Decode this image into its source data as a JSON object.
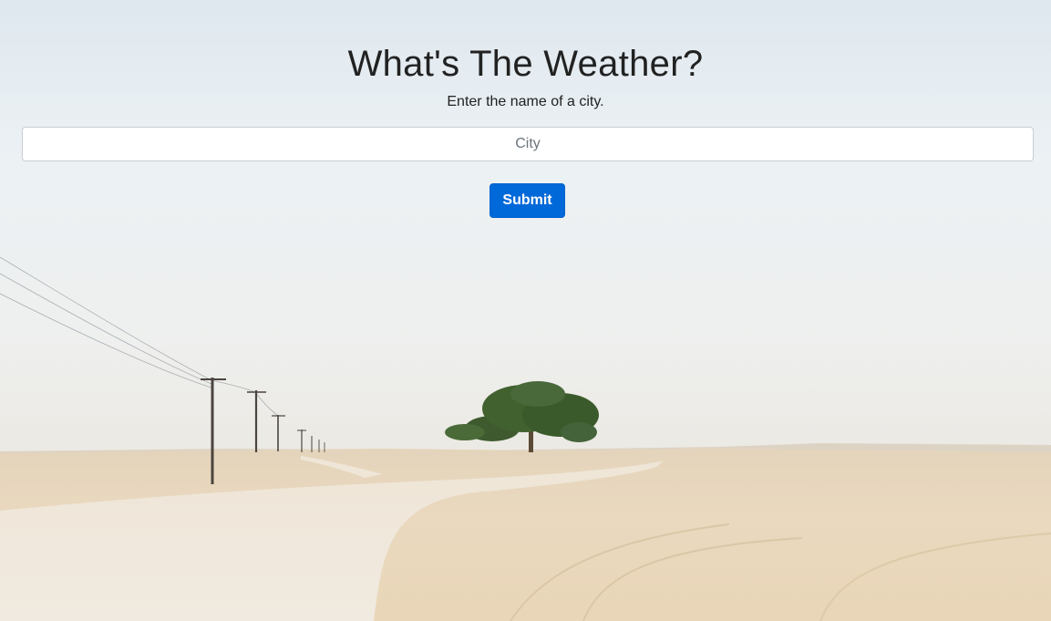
{
  "header": {
    "title": "What's The Weather?",
    "subtitle": "Enter the name of a city."
  },
  "form": {
    "city_placeholder": "City",
    "city_value": "",
    "submit_label": "Submit"
  },
  "colors": {
    "button": "#0069d9",
    "button_text": "#ffffff",
    "sky": "#e8eef3",
    "sand": "#e9d9be"
  },
  "background": {
    "scene": "desert-road-with-lone-tree-and-power-poles"
  }
}
